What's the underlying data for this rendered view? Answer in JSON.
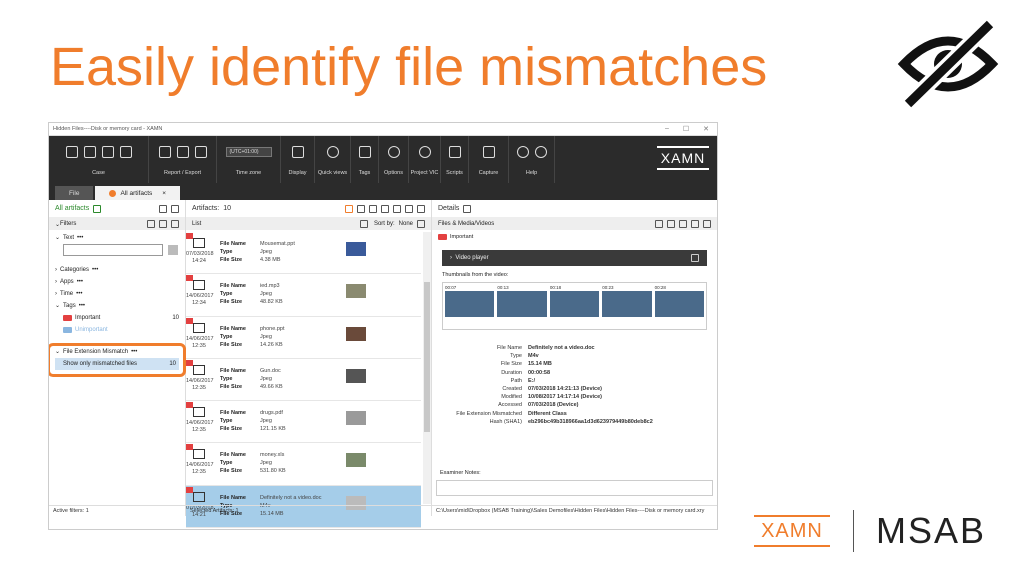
{
  "slide": {
    "title": "Easily identify file mismatches"
  },
  "window": {
    "title": "Hidden Files----Disk or memory card - XAMN"
  },
  "ribbon": {
    "groups": [
      {
        "label": "Case"
      },
      {
        "label": "Report / Export"
      },
      {
        "label": "Time zone"
      },
      {
        "label": "Display"
      },
      {
        "label": "Quick views"
      },
      {
        "label": "Tags"
      },
      {
        "label": "Options"
      },
      {
        "label": "Project VIC"
      },
      {
        "label": "Scripts"
      },
      {
        "label": "Capture"
      },
      {
        "label": "Help"
      }
    ],
    "timezone": "(UTC+01:00)",
    "logo": "XAMN"
  },
  "tabs": [
    {
      "label": "File"
    },
    {
      "label": "All artifacts",
      "close": "×"
    }
  ],
  "left": {
    "all_artifacts": "All artifacts",
    "filters": "Filters",
    "text": "Text",
    "categories": "Categories",
    "apps": "Apps",
    "time": "Time",
    "tags": "Tags",
    "important": "Important",
    "important_count": "10",
    "unimportant": "Unimportant",
    "mismatch": "File Extension Mismatch",
    "show_mismatched": "Show only mismatched files",
    "mismatched_count": "10",
    "footer": "Active filters: 1"
  },
  "mid": {
    "artifacts_label": "Artifacts:",
    "artifacts_count": "10",
    "list": "List",
    "sortby": "Sort by:",
    "sort_val": "None",
    "key_name": "File Name",
    "key_type": "Type",
    "key_size": "File Size",
    "items": [
      {
        "date": "07/03/2018",
        "time": "14:24",
        "name": "Mousemat.ppt",
        "type": "Jpeg",
        "size": "4.38 MB"
      },
      {
        "date": "14/06/2017",
        "time": "12:34",
        "name": "ied.mp3",
        "type": "Jpeg",
        "size": "48.82 KB"
      },
      {
        "date": "14/06/2017",
        "time": "12:35",
        "name": "phone.ppt",
        "type": "Jpeg",
        "size": "14.26 KB"
      },
      {
        "date": "14/06/2017",
        "time": "12:35",
        "name": "Gun.doc",
        "type": "Jpeg",
        "size": "49.66 KB"
      },
      {
        "date": "14/06/2017",
        "time": "12:35",
        "name": "drugs.pdf",
        "type": "Jpeg",
        "size": "121.15 KB"
      },
      {
        "date": "14/06/2017",
        "time": "12:35",
        "name": "money.xls",
        "type": "Jpeg",
        "size": "531.80 KB"
      },
      {
        "date": "07/03/2018",
        "time": "14:21",
        "name": "Definitely not a video.doc",
        "type": "M4v",
        "size": "15.14 MB"
      }
    ],
    "footer": "Selected Artifacts: 1"
  },
  "right": {
    "details": "Details",
    "section": "Files & Media/Videos",
    "important": "Important",
    "player": "Video player",
    "thumbs_label": "Thumbnails from the video:",
    "thumb_times": [
      "00:07",
      "00:13",
      "00:18",
      "00:23",
      "00:28"
    ],
    "meta": [
      {
        "k": "File Name",
        "v": "Definitely not a video.doc"
      },
      {
        "k": "Type",
        "v": "M4v"
      },
      {
        "k": "File Size",
        "v": "15.14 MB"
      },
      {
        "k": "Duration",
        "v": "00:00:58"
      },
      {
        "k": "Path",
        "v": "E:/"
      },
      {
        "k": "Created",
        "v": "07/03/2018 14:21:13 (Device)"
      },
      {
        "k": "Modified",
        "v": "10/08/2017 14:17:14 (Device)"
      },
      {
        "k": "Accessed",
        "v": "07/03/2018 (Device)"
      },
      {
        "k": "File Extension Mismatched",
        "v": "Different Class"
      },
      {
        "k": "Hash (SHA1)",
        "v": "eb296bc49b318966aa1d3d623979449b80deb8c2"
      }
    ],
    "notes": "Examiner Notes:",
    "footer": "C:\\Users\\mid\\Dropbox (MSAB Training)\\Sales Demofiles\\Hidden Files\\Hidden Files----Disk or memory card.xry"
  },
  "brand": {
    "xamn": "XAMN",
    "msab": "MSAB"
  }
}
